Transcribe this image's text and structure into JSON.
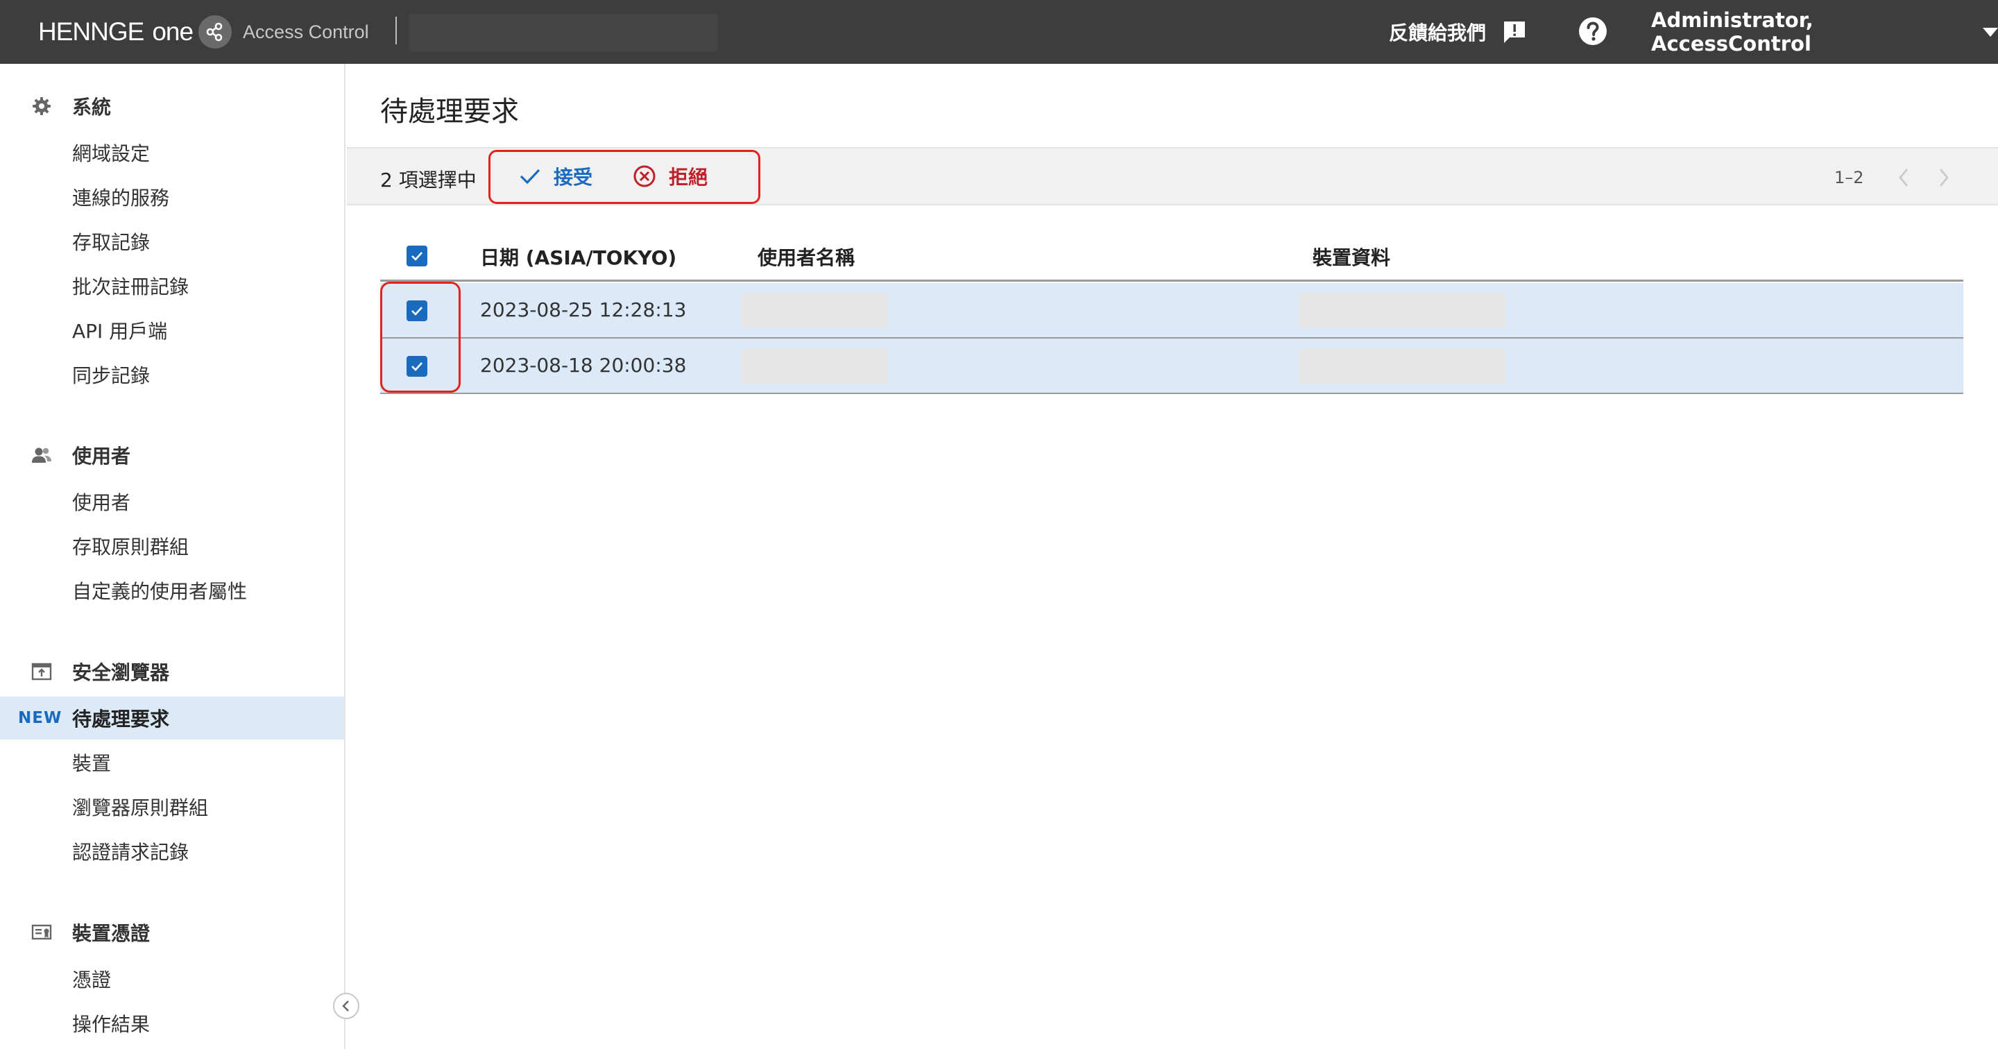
{
  "topbar": {
    "brand_word": "HENNGE",
    "brand_one": "one",
    "app_name": "Access Control",
    "feedback_label": "反饋給我們",
    "user_name": "Administrator, AccessControl"
  },
  "sidebar": {
    "sections": [
      {
        "title": "系統",
        "icon": "gear-icon",
        "items": [
          "網域設定",
          "連線的服務",
          "存取記錄",
          "批次註冊記錄",
          "API 用戶端",
          "同步記錄"
        ]
      },
      {
        "title": "使用者",
        "icon": "users-icon",
        "items": [
          "使用者",
          "存取原則群組",
          "自定義的使用者屬性"
        ]
      },
      {
        "title": "安全瀏覽器",
        "icon": "browser-icon",
        "items": [
          "待處理要求",
          "裝置",
          "瀏覽器原則群組",
          "認證請求記錄"
        ]
      },
      {
        "title": "裝置憑證",
        "icon": "certificate-icon",
        "items": [
          "憑證",
          "操作結果"
        ]
      }
    ],
    "active_item": "待處理要求",
    "new_badge": "NEW"
  },
  "main": {
    "title": "待處理要求",
    "selection_count": "2 項選擇中",
    "accept_label": "接受",
    "reject_label": "拒絕",
    "pager_range": "1–2",
    "table": {
      "columns": [
        "日期 (ASIA/TOKYO)",
        "使用者名稱",
        "裝置資料"
      ],
      "rows": [
        {
          "date": "2023-08-25 12:28:13",
          "checked": true
        },
        {
          "date": "2023-08-18 20:00:38",
          "checked": true
        }
      ]
    }
  },
  "colors": {
    "topbar_bg": "#3d3d3d",
    "accent_blue": "#1a6bbf",
    "reject_red": "#c0202a",
    "highlight_red": "#e0241b",
    "selected_row_bg": "#dbe9f8"
  }
}
